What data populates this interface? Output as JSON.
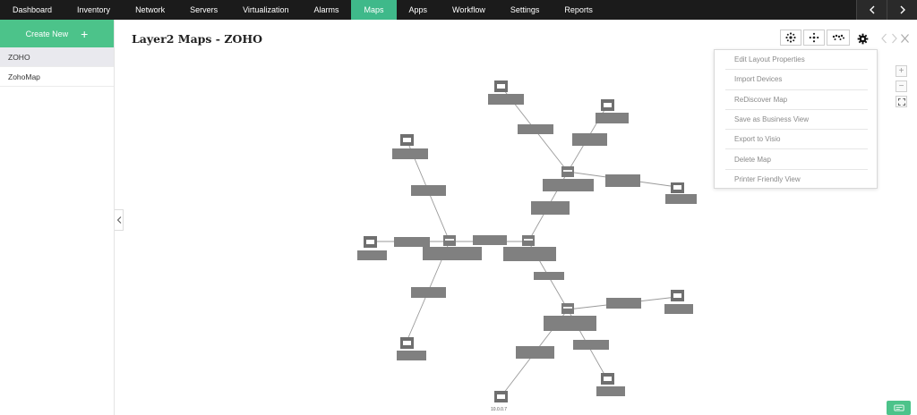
{
  "nav": {
    "items": [
      "Dashboard",
      "Inventory",
      "Network",
      "Servers",
      "Virtualization",
      "Alarms",
      "Maps",
      "Apps",
      "Workflow",
      "Settings",
      "Reports"
    ],
    "active": "Maps"
  },
  "sidebar": {
    "create_new_label": "Create New",
    "items": [
      {
        "label": "ZOHO",
        "selected": true
      },
      {
        "label": "ZohoMap",
        "selected": false
      }
    ]
  },
  "header": {
    "title": "Layer2 Maps - ZOHO"
  },
  "settings_menu": {
    "items": [
      "Edit Layout Properties",
      "Import Devices",
      "ReDiscover Map",
      "Save as Business View",
      "Export to Visio",
      "Delete Map",
      "Printer Friendly View"
    ]
  },
  "zoom": {
    "in_label": "+",
    "out_label": "−"
  },
  "map": {
    "visible_label": "10.0.0.7"
  },
  "colors": {
    "nav_bg": "#1b1b1b",
    "accent": "#4cc38a",
    "label_box": "#7f7f7f",
    "link": "#9a9a9a"
  }
}
